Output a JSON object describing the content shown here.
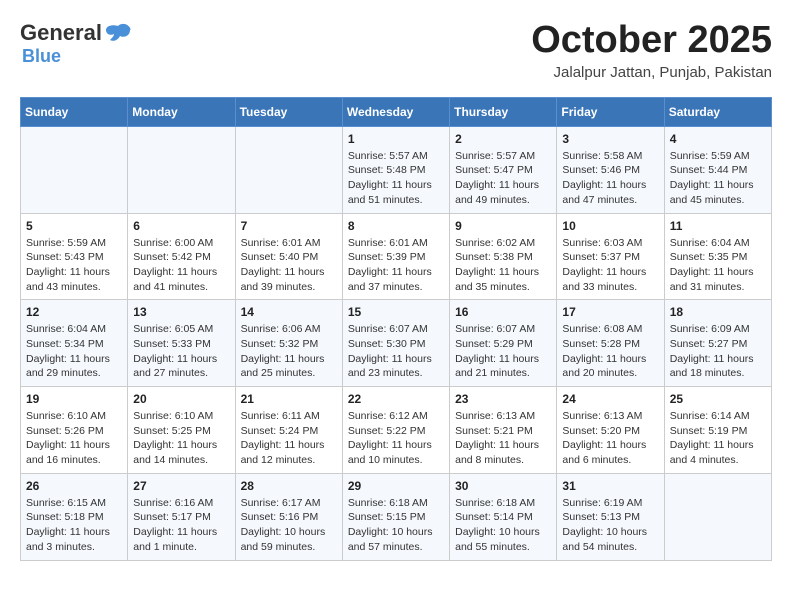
{
  "header": {
    "logo": {
      "general": "General",
      "blue": "Blue"
    },
    "title": "October 2025",
    "subtitle": "Jalalpur Jattan, Punjab, Pakistan"
  },
  "weekdays": [
    "Sunday",
    "Monday",
    "Tuesday",
    "Wednesday",
    "Thursday",
    "Friday",
    "Saturday"
  ],
  "weeks": [
    [
      {
        "day": "",
        "info": ""
      },
      {
        "day": "",
        "info": ""
      },
      {
        "day": "",
        "info": ""
      },
      {
        "day": "1",
        "info": "Sunrise: 5:57 AM\nSunset: 5:48 PM\nDaylight: 11 hours\nand 51 minutes."
      },
      {
        "day": "2",
        "info": "Sunrise: 5:57 AM\nSunset: 5:47 PM\nDaylight: 11 hours\nand 49 minutes."
      },
      {
        "day": "3",
        "info": "Sunrise: 5:58 AM\nSunset: 5:46 PM\nDaylight: 11 hours\nand 47 minutes."
      },
      {
        "day": "4",
        "info": "Sunrise: 5:59 AM\nSunset: 5:44 PM\nDaylight: 11 hours\nand 45 minutes."
      }
    ],
    [
      {
        "day": "5",
        "info": "Sunrise: 5:59 AM\nSunset: 5:43 PM\nDaylight: 11 hours\nand 43 minutes."
      },
      {
        "day": "6",
        "info": "Sunrise: 6:00 AM\nSunset: 5:42 PM\nDaylight: 11 hours\nand 41 minutes."
      },
      {
        "day": "7",
        "info": "Sunrise: 6:01 AM\nSunset: 5:40 PM\nDaylight: 11 hours\nand 39 minutes."
      },
      {
        "day": "8",
        "info": "Sunrise: 6:01 AM\nSunset: 5:39 PM\nDaylight: 11 hours\nand 37 minutes."
      },
      {
        "day": "9",
        "info": "Sunrise: 6:02 AM\nSunset: 5:38 PM\nDaylight: 11 hours\nand 35 minutes."
      },
      {
        "day": "10",
        "info": "Sunrise: 6:03 AM\nSunset: 5:37 PM\nDaylight: 11 hours\nand 33 minutes."
      },
      {
        "day": "11",
        "info": "Sunrise: 6:04 AM\nSunset: 5:35 PM\nDaylight: 11 hours\nand 31 minutes."
      }
    ],
    [
      {
        "day": "12",
        "info": "Sunrise: 6:04 AM\nSunset: 5:34 PM\nDaylight: 11 hours\nand 29 minutes."
      },
      {
        "day": "13",
        "info": "Sunrise: 6:05 AM\nSunset: 5:33 PM\nDaylight: 11 hours\nand 27 minutes."
      },
      {
        "day": "14",
        "info": "Sunrise: 6:06 AM\nSunset: 5:32 PM\nDaylight: 11 hours\nand 25 minutes."
      },
      {
        "day": "15",
        "info": "Sunrise: 6:07 AM\nSunset: 5:30 PM\nDaylight: 11 hours\nand 23 minutes."
      },
      {
        "day": "16",
        "info": "Sunrise: 6:07 AM\nSunset: 5:29 PM\nDaylight: 11 hours\nand 21 minutes."
      },
      {
        "day": "17",
        "info": "Sunrise: 6:08 AM\nSunset: 5:28 PM\nDaylight: 11 hours\nand 20 minutes."
      },
      {
        "day": "18",
        "info": "Sunrise: 6:09 AM\nSunset: 5:27 PM\nDaylight: 11 hours\nand 18 minutes."
      }
    ],
    [
      {
        "day": "19",
        "info": "Sunrise: 6:10 AM\nSunset: 5:26 PM\nDaylight: 11 hours\nand 16 minutes."
      },
      {
        "day": "20",
        "info": "Sunrise: 6:10 AM\nSunset: 5:25 PM\nDaylight: 11 hours\nand 14 minutes."
      },
      {
        "day": "21",
        "info": "Sunrise: 6:11 AM\nSunset: 5:24 PM\nDaylight: 11 hours\nand 12 minutes."
      },
      {
        "day": "22",
        "info": "Sunrise: 6:12 AM\nSunset: 5:22 PM\nDaylight: 11 hours\nand 10 minutes."
      },
      {
        "day": "23",
        "info": "Sunrise: 6:13 AM\nSunset: 5:21 PM\nDaylight: 11 hours\nand 8 minutes."
      },
      {
        "day": "24",
        "info": "Sunrise: 6:13 AM\nSunset: 5:20 PM\nDaylight: 11 hours\nand 6 minutes."
      },
      {
        "day": "25",
        "info": "Sunrise: 6:14 AM\nSunset: 5:19 PM\nDaylight: 11 hours\nand 4 minutes."
      }
    ],
    [
      {
        "day": "26",
        "info": "Sunrise: 6:15 AM\nSunset: 5:18 PM\nDaylight: 11 hours\nand 3 minutes."
      },
      {
        "day": "27",
        "info": "Sunrise: 6:16 AM\nSunset: 5:17 PM\nDaylight: 11 hours\nand 1 minute."
      },
      {
        "day": "28",
        "info": "Sunrise: 6:17 AM\nSunset: 5:16 PM\nDaylight: 10 hours\nand 59 minutes."
      },
      {
        "day": "29",
        "info": "Sunrise: 6:18 AM\nSunset: 5:15 PM\nDaylight: 10 hours\nand 57 minutes."
      },
      {
        "day": "30",
        "info": "Sunrise: 6:18 AM\nSunset: 5:14 PM\nDaylight: 10 hours\nand 55 minutes."
      },
      {
        "day": "31",
        "info": "Sunrise: 6:19 AM\nSunset: 5:13 PM\nDaylight: 10 hours\nand 54 minutes."
      },
      {
        "day": "",
        "info": ""
      }
    ]
  ]
}
